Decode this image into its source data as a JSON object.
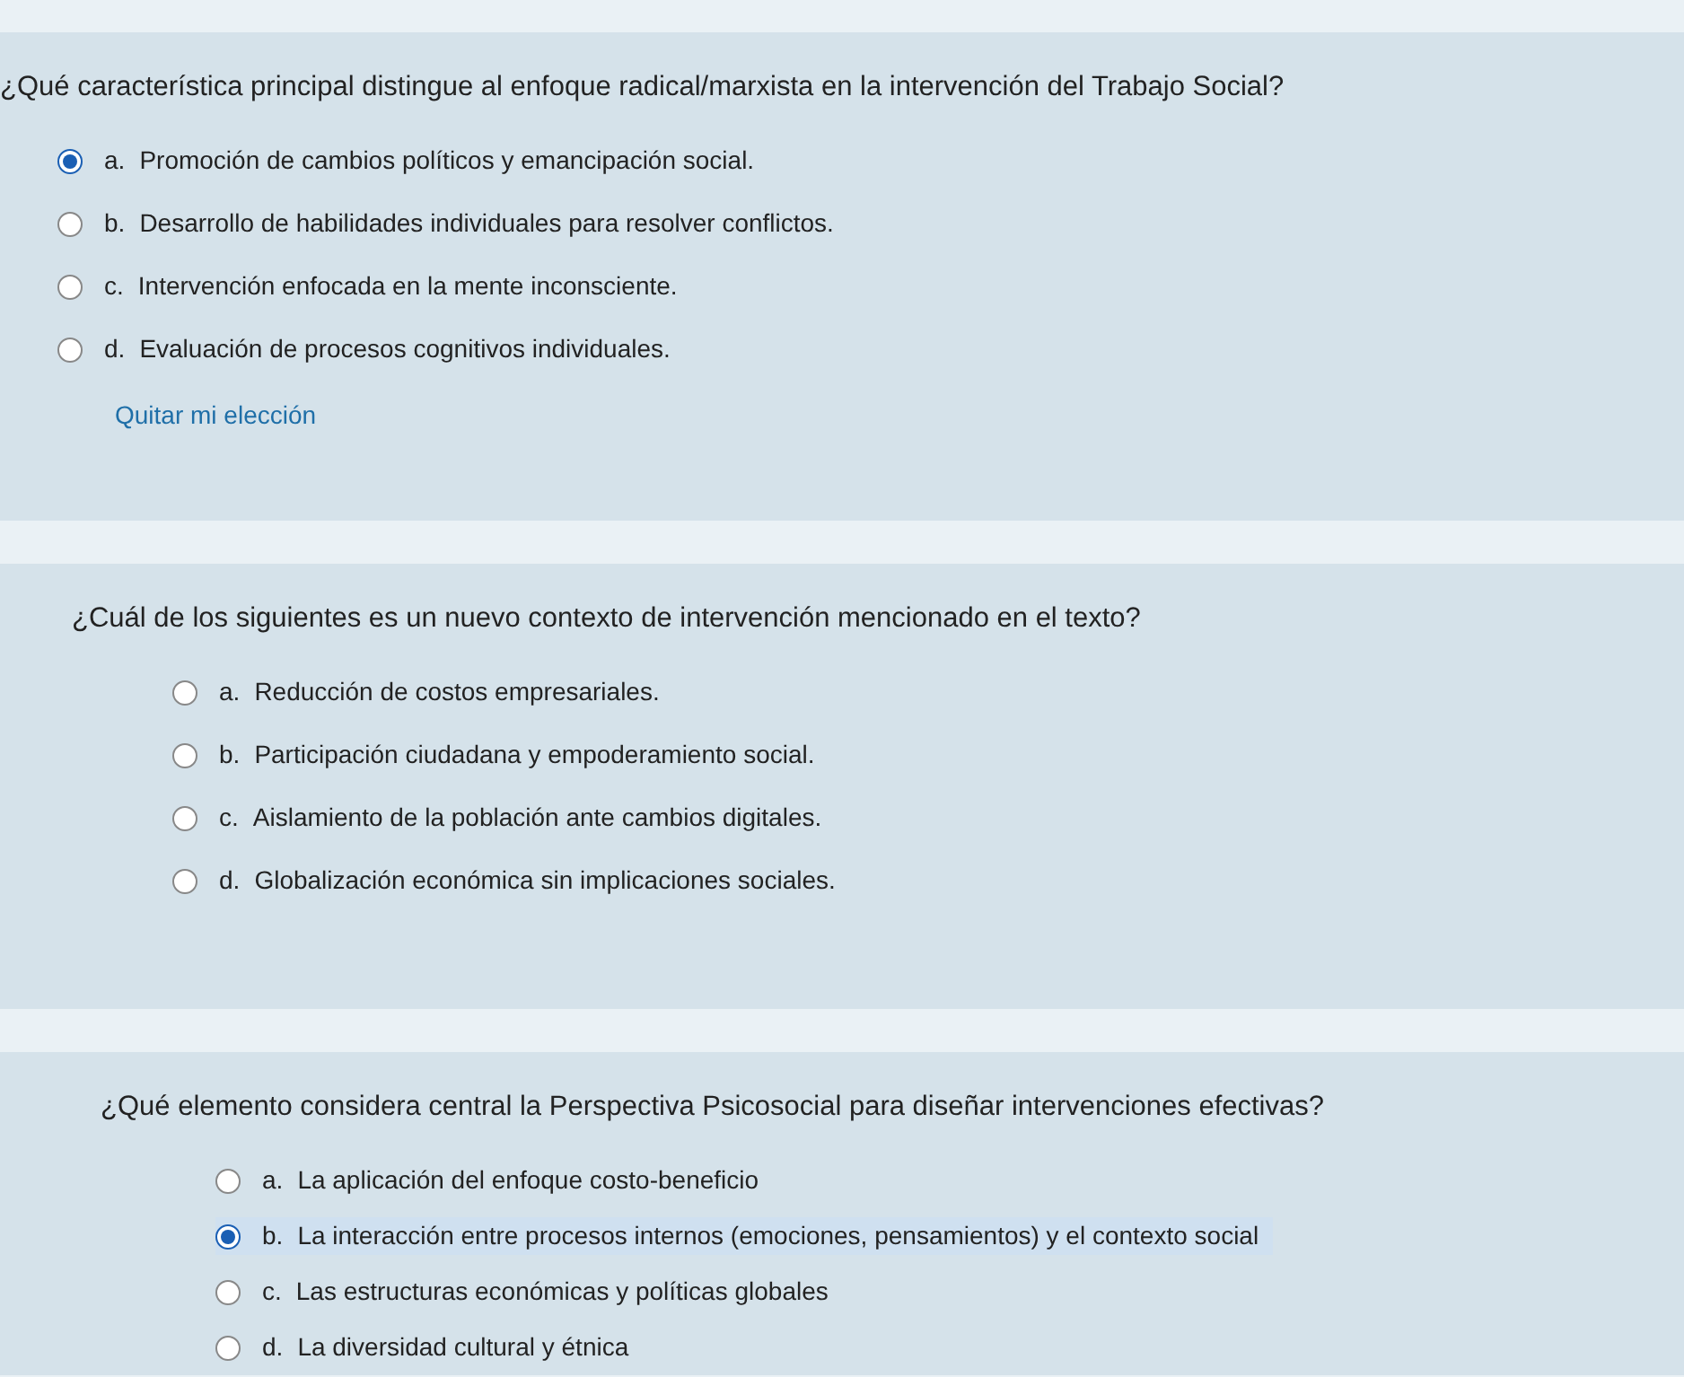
{
  "questions": [
    {
      "text": "¿Qué característica principal distingue al enfoque radical/marxista en la intervención del Trabajo Social?",
      "options": [
        {
          "letter": "a.",
          "text": "Promoción de cambios políticos y emancipación social.",
          "selected": true
        },
        {
          "letter": "b.",
          "text": "Desarrollo de habilidades individuales para resolver conflictos.",
          "selected": false
        },
        {
          "letter": "c.",
          "text": "Intervención enfocada en la mente inconsciente.",
          "selected": false
        },
        {
          "letter": "d.",
          "text": "Evaluación de procesos cognitivos individuales.",
          "selected": false
        }
      ],
      "clear_link": "Quitar mi elección"
    },
    {
      "text": "¿Cuál de los siguientes es un nuevo contexto de intervención mencionado en el texto?",
      "options": [
        {
          "letter": "a.",
          "text": "Reducción de costos empresariales.",
          "selected": false
        },
        {
          "letter": "b.",
          "text": "Participación ciudadana y empoderamiento social.",
          "selected": false
        },
        {
          "letter": "c.",
          "text": "Aislamiento de la población ante cambios digitales.",
          "selected": false
        },
        {
          "letter": "d.",
          "text": "Globalización económica sin implicaciones sociales.",
          "selected": false
        }
      ]
    },
    {
      "text": "¿Qué elemento considera central la Perspectiva Psicosocial para diseñar intervenciones efectivas?",
      "options": [
        {
          "letter": "a.",
          "text": "La aplicación del enfoque costo-beneficio",
          "selected": false
        },
        {
          "letter": "b.",
          "text": "La interacción entre procesos internos (emociones, pensamientos) y el contexto social",
          "selected": true
        },
        {
          "letter": "c.",
          "text": "Las estructuras económicas y políticas globales",
          "selected": false
        },
        {
          "letter": "d.",
          "text": "La diversidad cultural y étnica",
          "selected": false
        }
      ]
    }
  ]
}
